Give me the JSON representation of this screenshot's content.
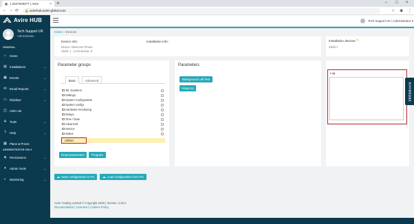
{
  "browser": {
    "tab_title": "1.2527526677 | Avire",
    "tab_close": "×",
    "new_tab": "+",
    "url": "avirehub.avire-global.com",
    "back": "←",
    "forward": "→",
    "reload": "⟳",
    "lock": "🔒",
    "star": "☆",
    "profile_icon": "◉",
    "menu": "⋮",
    "win_min": "–",
    "win_max": "□",
    "win_close": "×"
  },
  "sidebar": {
    "logo_text": "Avire HUB",
    "user_name": "Tech Support UK",
    "user_role": "Administrator",
    "general_label": "GENERAL",
    "admin_label": "ADMINISTRATOR ONLY",
    "items": [
      {
        "label": "Home",
        "icon": "⌂",
        "chev": ""
      },
      {
        "label": "Installations",
        "icon": "▤",
        "chev": "⌄"
      },
      {
        "label": "Events",
        "icon": "▣",
        "chev": "⌄"
      },
      {
        "label": "Email Reports",
        "icon": "✉",
        "chev": "⌄"
      },
      {
        "label": "Displays",
        "icon": "▭",
        "chev": "⌄"
      },
      {
        "label": "LMS Lite",
        "icon": "◫",
        "chev": ""
      },
      {
        "label": "Tools",
        "icon": "✣",
        "chev": "⌄"
      },
      {
        "label": "Help",
        "icon": "?",
        "chev": "⌄"
      },
      {
        "label": "Plans & Prices",
        "icon": "▦",
        "chev": ""
      }
    ],
    "admin_items": [
      {
        "label": "Permissions",
        "icon": "◈",
        "chev": "⌄"
      },
      {
        "label": "Admin Tools",
        "icon": "✦",
        "chev": "⌄"
      },
      {
        "label": "Monitoring",
        "icon": "◐",
        "chev": "⌄"
      }
    ]
  },
  "header": {
    "user_menu": "Tech Support UK | Administrator ▾"
  },
  "breadcrumb": {
    "home": "Home",
    "sep": " » ",
    "current": "Devices"
  },
  "device_info": {
    "title": "Device Info:",
    "device_line": "Device: Memcom Phone",
    "shaft_line": "Shaft: 1 - CAN device: 8",
    "installation_title": "Installation info:"
  },
  "installation_devices": {
    "title": "Installation devices",
    "edit_icon": "✎",
    "value": "Shaft 1"
  },
  "parameter_groups": {
    "title": "Parameter groups",
    "tab_basic": "Basic",
    "tab_advanced": "Advanced",
    "items": [
      "Tel. Numbers",
      "Settings",
      "System Configuration",
      "System configr",
      "Hardware monitoring",
      "Delays",
      "Time / Date",
      "Advanced",
      "Service",
      "Status",
      "Utilities"
    ],
    "selected": "Utilities",
    "read_button": "Read parameters",
    "program_button": "Program"
  },
  "parameters": {
    "title": "Parameters",
    "bg_call_button": "Background call Test",
    "hangup_button": "Hang-Up"
  },
  "log": {
    "label": "Log",
    "content": ""
  },
  "actions": {
    "save_button": "Save configuration to PC",
    "load_button": "Load configuration from PC",
    "save_icon": "☁",
    "load_icon": "☁"
  },
  "feedback": "FEEDBACK",
  "footer": {
    "copyright": "Avire Trading Limited © Copyright 2020 | Version: 4.25.2",
    "documentation": "Documentation",
    "licenses": "Licenses",
    "cookie_policy": "Cookies Policy",
    "sep": " | "
  },
  "colors": {
    "sidebar": "#0b3a4f",
    "accent": "#24a9b8",
    "highlight_outline": "#b0202a",
    "selected_row": "#fdeeb2"
  }
}
